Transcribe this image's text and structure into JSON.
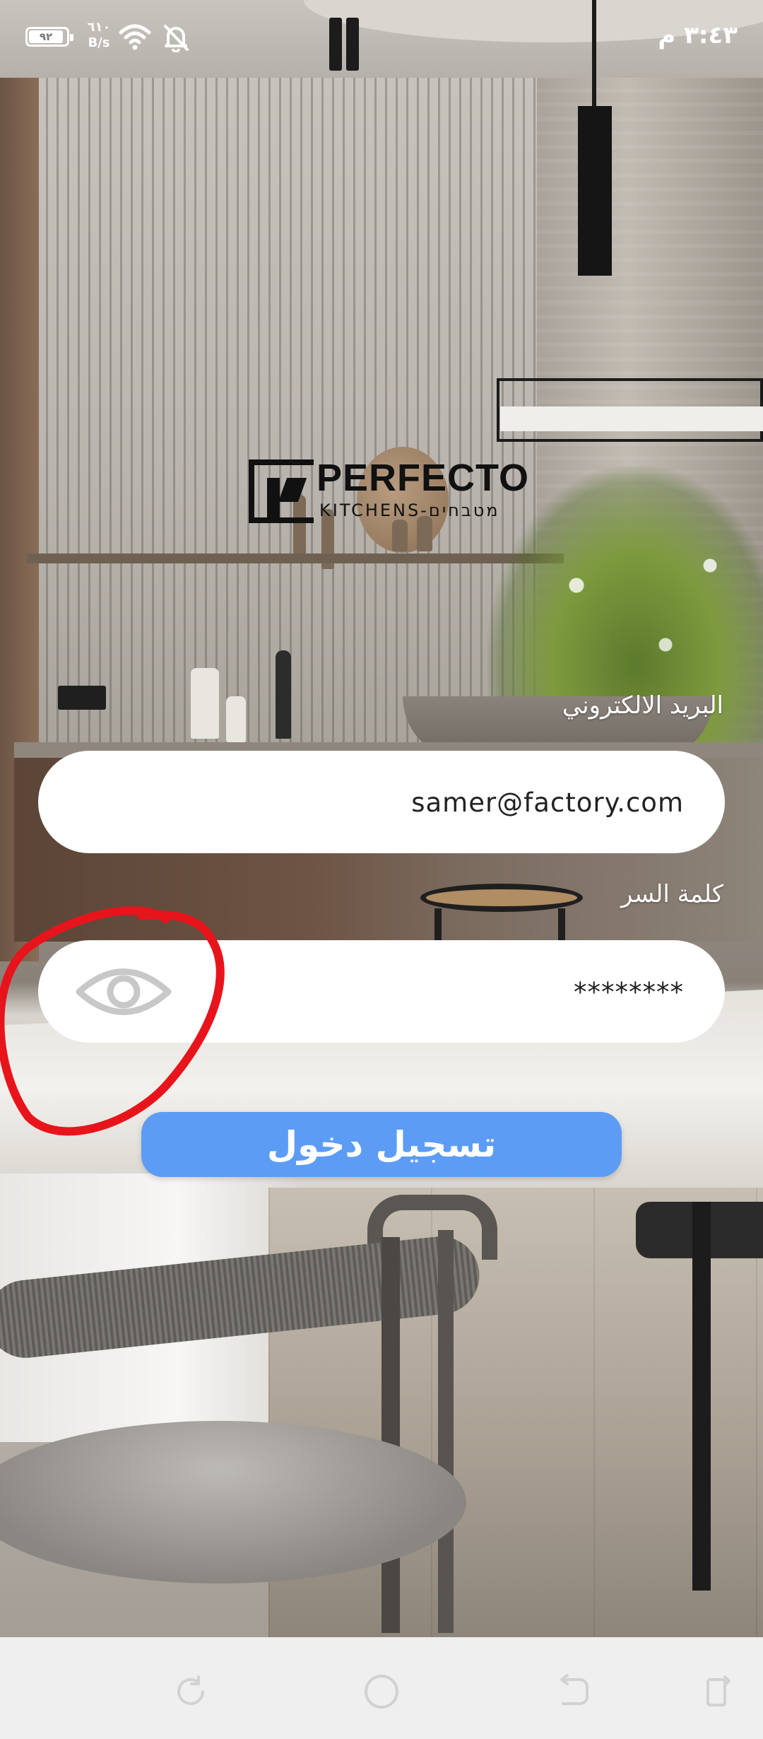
{
  "status_bar": {
    "battery_level": "٩٢",
    "net_speed_value": "٦١٠",
    "net_speed_unit": "B/s",
    "time": "٣:٤٣ م"
  },
  "logo": {
    "brand": "PERFECTO",
    "tagline": "KITCHENS-מטבחים"
  },
  "form": {
    "email_label": "البريد الالكتروني",
    "email_value": "samer@factory.com",
    "password_label": "كلمة السر",
    "password_value": "********",
    "login_button": "تسجيل دخول"
  },
  "colors": {
    "button_bg": "#5d9cf5",
    "annotation": "#e8141c"
  },
  "icons": {
    "password_toggle": "eye-icon",
    "nav": [
      "rotate-icon",
      "home-icon",
      "back-icon",
      "recent-apps-icon"
    ]
  }
}
